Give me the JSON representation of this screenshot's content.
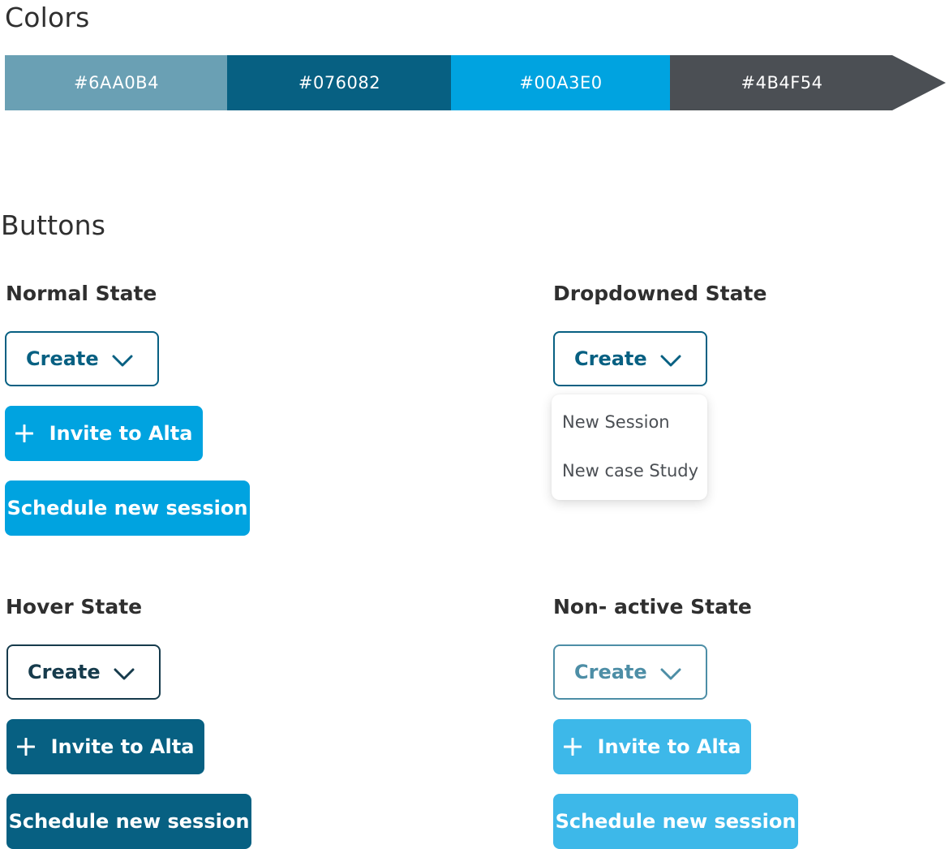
{
  "sections": {
    "colors_title": "Colors",
    "buttons_title": "Buttons"
  },
  "palette": [
    {
      "label": "#6AA0B4",
      "color": "#6aa0b4"
    },
    {
      "label": "#076082",
      "color": "#076082"
    },
    {
      "label": "#00A3E0",
      "color": "#00a3e0"
    },
    {
      "label": "#4B4F54",
      "color": "#4b4f54"
    }
  ],
  "states": {
    "normal": "Normal State",
    "dropdowned": "Dropdowned State",
    "hover": "Hover State",
    "non_active": "Non- active State"
  },
  "buttons": {
    "create": "Create",
    "invite": "Invite to Alta",
    "schedule": "Schedule new session"
  },
  "dropdown": {
    "items": [
      "New Session",
      "New case Study"
    ]
  },
  "icons": {
    "chevron": "chevron-down-icon",
    "plus": "plus-icon"
  },
  "colors": {
    "primary": "#00A3E0",
    "dark": "#076082",
    "muted": "#6AA0B4",
    "text": "#4B4F54"
  }
}
